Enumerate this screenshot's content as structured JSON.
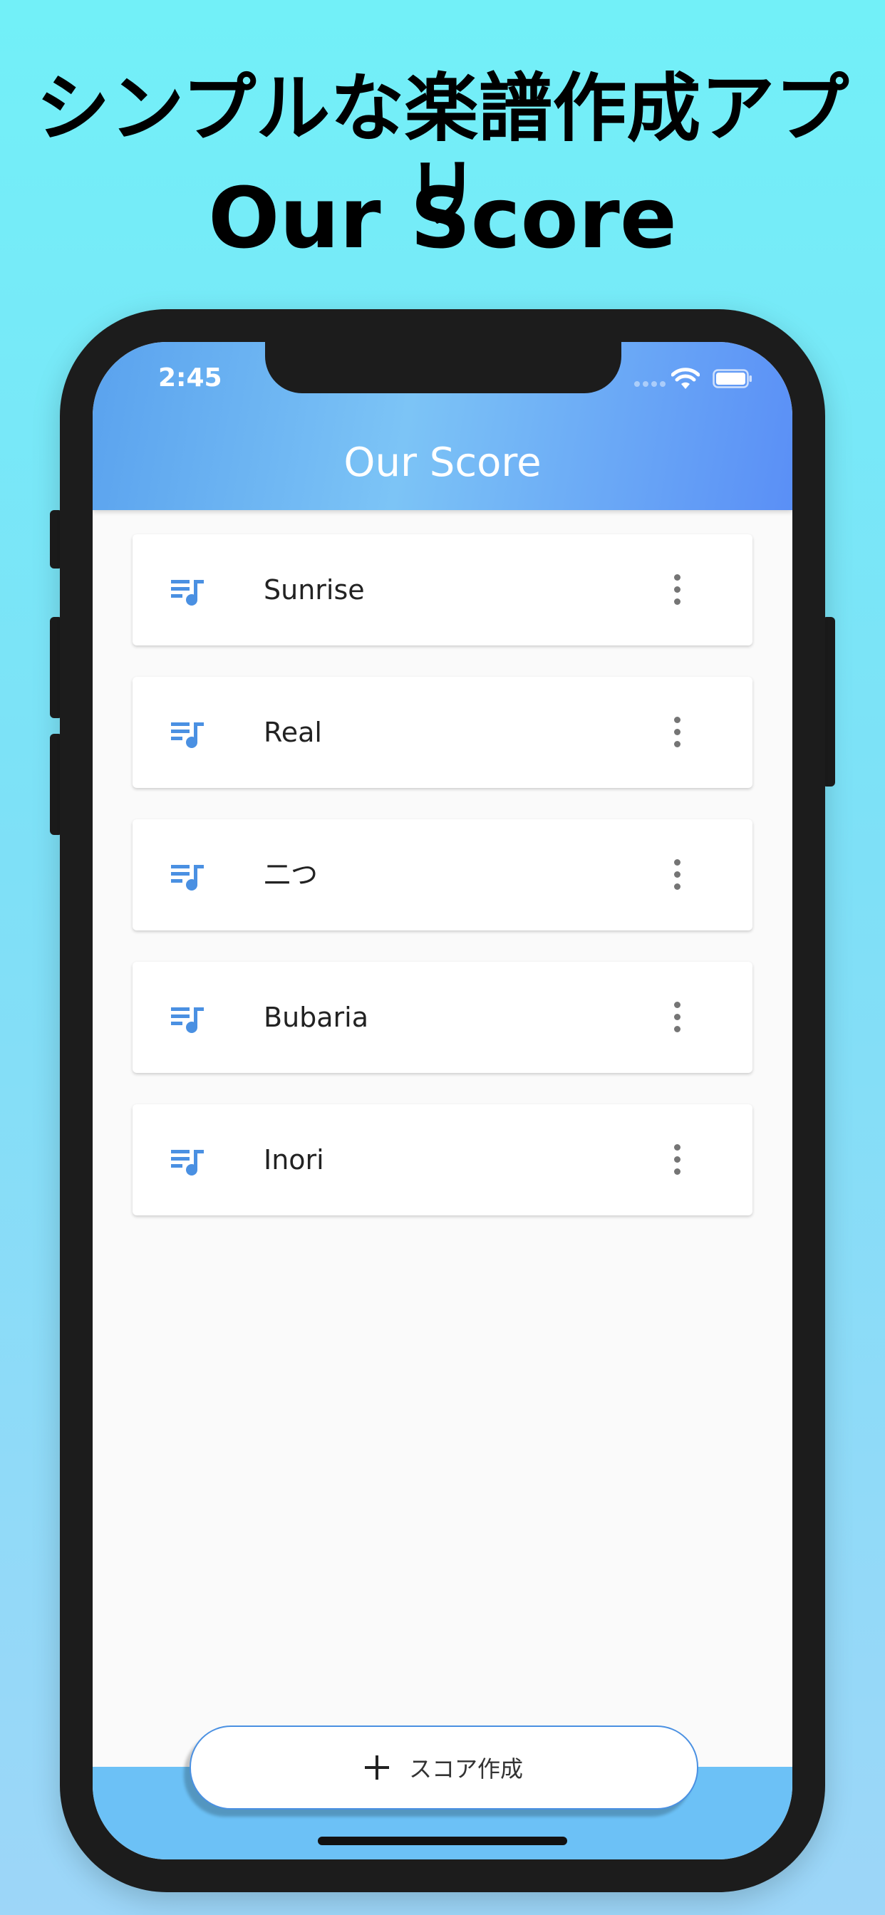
{
  "promo": {
    "headline": "シンプルな楽譜作成アプリ",
    "app_name": "Our Score"
  },
  "status_bar": {
    "time": "2:45",
    "wifi_icon": "wifi-icon",
    "battery_icon": "battery-icon"
  },
  "app_bar": {
    "title": "Our Score",
    "color_start": "#5aa2ee",
    "color_end": "#5a8ff6"
  },
  "scores": [
    {
      "title": "Sunrise",
      "icon": "queue-music-icon",
      "menu_icon": "more-vert-icon"
    },
    {
      "title": "Real",
      "icon": "queue-music-icon",
      "menu_icon": "more-vert-icon"
    },
    {
      "title": "二つ",
      "icon": "queue-music-icon",
      "menu_icon": "more-vert-icon"
    },
    {
      "title": "Bubaria",
      "icon": "queue-music-icon",
      "menu_icon": "more-vert-icon"
    },
    {
      "title": "Inori",
      "icon": "queue-music-icon",
      "menu_icon": "more-vert-icon"
    }
  ],
  "create_button": {
    "label": "スコア作成",
    "icon": "plus-icon"
  },
  "colors": {
    "accent": "#4a90e2",
    "bottom_bar": "#6cc1f6"
  }
}
